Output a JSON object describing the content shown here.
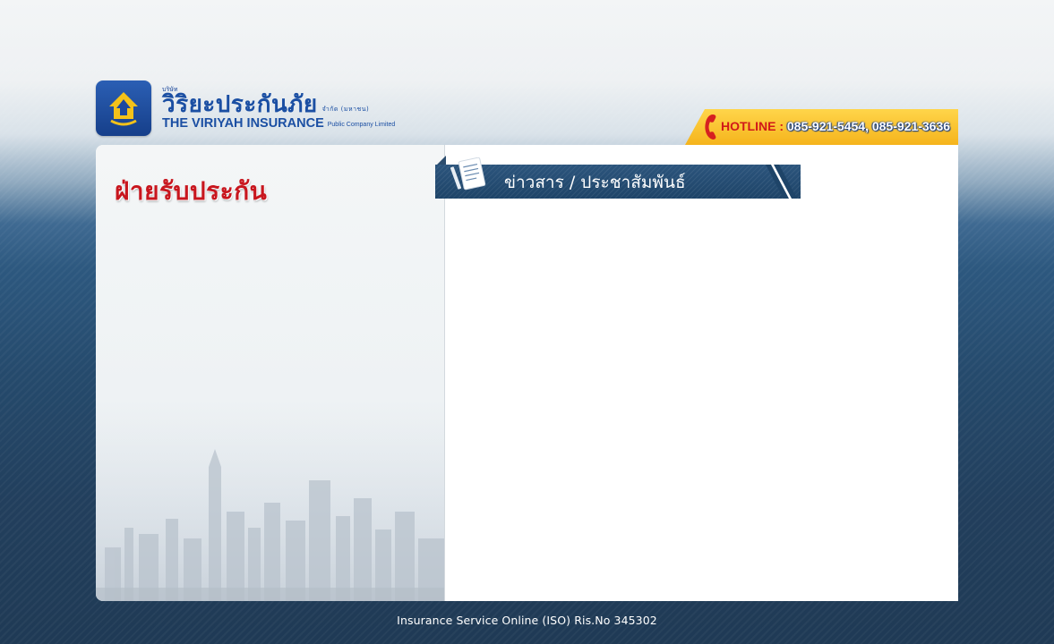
{
  "header": {
    "company_prefix": "บริษัท",
    "company_thai": "วิริยะประกันภัย",
    "company_thai_suffix": "จำกัด (มหาชน)",
    "company_en": "THE VIRIYAH INSURANCE",
    "company_en_suffix": "Public Company Limited",
    "logo_icon": "viriyah-emblem-icon"
  },
  "hotline": {
    "label": "HOTLINE :",
    "numbers": "085-921-5454, 085-921-3636",
    "icon": "phone-icon"
  },
  "left_panel": {
    "title": "ฝ่ายรับประกัน"
  },
  "news": {
    "title": "ข่าวสาร / ประชาสัมพันธ์",
    "icon": "document-icon"
  },
  "footer": {
    "text": "Insurance Service Online (ISO) Ris.No 345302"
  },
  "colors": {
    "brand_blue": "#1b4fa3",
    "accent_yellow": "#f5b41c",
    "title_red": "#c8161e",
    "bar_navy": "#1e4468"
  }
}
